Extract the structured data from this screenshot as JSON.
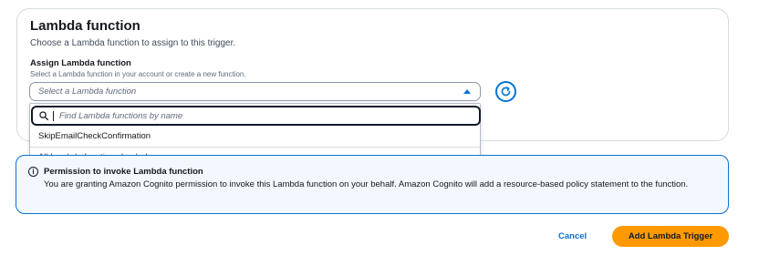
{
  "section": {
    "title": "Lambda function",
    "description": "Choose a Lambda function to assign to this trigger."
  },
  "field": {
    "label": "Assign Lambda function",
    "description": "Select a Lambda function in your account or create a new function.",
    "select_placeholder": "Select a Lambda function"
  },
  "dropdown": {
    "search_placeholder": "Find Lambda functions by name",
    "options": [
      "SkipEmailCheckConfirmation"
    ],
    "status": "All Lambda functions loaded"
  },
  "alert": {
    "title": "Permission to invoke Lambda function",
    "body": "You are granting Amazon Cognito permission to invoke this Lambda function on your behalf. Amazon Cognito will add a resource-based policy statement to the function."
  },
  "actions": {
    "cancel": "Cancel",
    "primary": "Add Lambda Trigger"
  },
  "colors": {
    "accent": "#0972d3",
    "primary_button": "#ff9900",
    "alert_background": "#f2f8fd"
  },
  "icons": {
    "caret": "caret-up-icon",
    "refresh": "refresh-icon",
    "search": "search-icon",
    "info": "info-icon"
  }
}
